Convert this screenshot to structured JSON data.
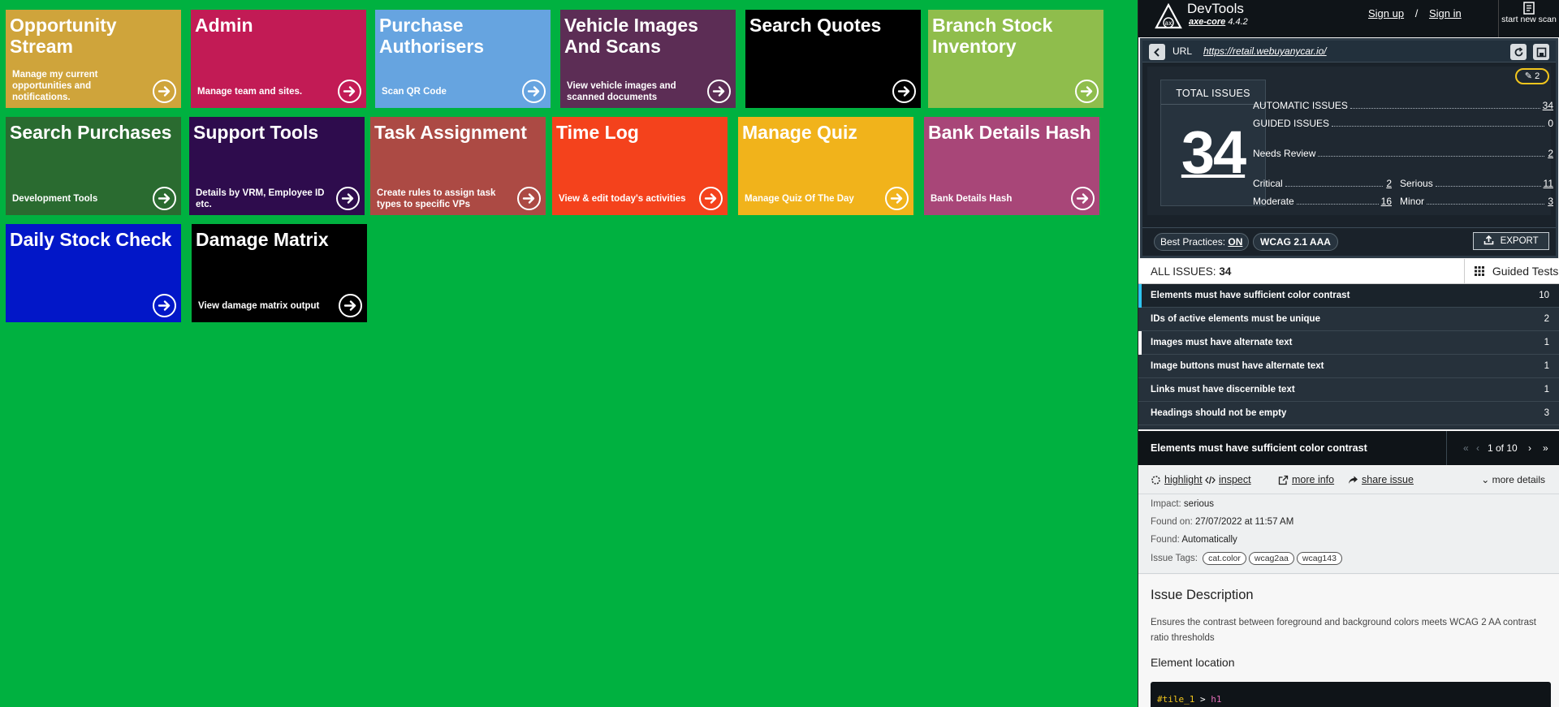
{
  "tiles": [
    {
      "title": "Opportunity Stream",
      "desc": "Manage my current opportunities and notifications.",
      "color": "#cfa43b"
    },
    {
      "title": "Admin",
      "desc": "Manage team and sites.",
      "color": "#c21b55"
    },
    {
      "title": "Purchase Authorisers",
      "desc": "Scan QR Code",
      "color": "#66a4e0"
    },
    {
      "title": "Vehicle Images And Scans",
      "desc": "View vehicle images and scanned documents",
      "color": "#5c2d55"
    },
    {
      "title": "Search Quotes",
      "desc": "",
      "color": "#000000"
    },
    {
      "title": "Branch Stock Inventory",
      "desc": "",
      "color": "#8fbd4c"
    },
    {
      "title": "Search Purchases",
      "desc": "Development Tools",
      "color": "#2a6b30"
    },
    {
      "title": "Support Tools",
      "desc": "Details by VRM, Employee ID etc.",
      "color": "#2e0c4d"
    },
    {
      "title": "Task Assignment",
      "desc": "Create rules to assign task types to specific VPs",
      "color": "#ac4a44"
    },
    {
      "title": "Time Log",
      "desc": "View & edit today's activities",
      "color": "#f4421c"
    },
    {
      "title": "Manage Quiz",
      "desc": "Manage Quiz Of The Day",
      "color": "#f1b31b"
    },
    {
      "title": "Bank Details Hash",
      "desc": "Bank Details Hash",
      "color": "#a84678"
    },
    {
      "title": "Daily Stock Check",
      "desc": "",
      "color": "#0217c8"
    },
    {
      "title": "Damage Matrix",
      "desc": "View damage matrix output",
      "color": "#000000"
    }
  ],
  "devtools": {
    "title": "DevTools",
    "core_name": "axe-core",
    "version": "4.4.2",
    "sign_up": "Sign up",
    "separator": "/",
    "sign_in": "Sign in",
    "new_scan": "start new scan",
    "url_label": "URL",
    "url": "https://retail.webuyanycar.io/",
    "edit_count": "2",
    "total_label": "TOTAL ISSUES",
    "total": "34",
    "stats": {
      "automatic": {
        "label": "AUTOMATIC ISSUES",
        "value": "34"
      },
      "guided": {
        "label": "GUIDED ISSUES",
        "value": "0"
      },
      "needs_review": {
        "label": "Needs Review",
        "value": "2"
      },
      "critical": {
        "label": "Critical",
        "value": "2"
      },
      "serious": {
        "label": "Serious",
        "value": "11"
      },
      "moderate": {
        "label": "Moderate",
        "value": "16"
      },
      "minor": {
        "label": "Minor",
        "value": "3"
      }
    },
    "best_practices_label": "Best Practices:",
    "best_practices_value": "ON",
    "wcag": "WCAG 2.1 AAA",
    "export": "EXPORT",
    "all_issues_label": "ALL ISSUES:",
    "all_issues_count": "34",
    "guided_tests": "Guided Tests",
    "issues": [
      {
        "label": "Elements must have sufficient color contrast",
        "count": "10",
        "marker": "#2ec4f0"
      },
      {
        "label": "IDs of active elements must be unique",
        "count": "2",
        "marker": ""
      },
      {
        "label": "Images must have alternate text",
        "count": "1",
        "marker": "#ffffff"
      },
      {
        "label": "Image buttons must have alternate text",
        "count": "1",
        "marker": ""
      },
      {
        "label": "Links must have discernible text",
        "count": "1",
        "marker": ""
      },
      {
        "label": "Headings should not be empty",
        "count": "3",
        "marker": ""
      }
    ],
    "detail": {
      "title": "Elements must have sufficient color contrast",
      "pager": "1 of 10",
      "actions": {
        "highlight": "highlight",
        "inspect": "inspect",
        "more_info": "more info",
        "share": "share issue",
        "more_details": "more details"
      },
      "impact_label": "Impact:",
      "impact": "serious",
      "found_on_label": "Found on:",
      "found_on": "27/07/2022 at 11:57 AM",
      "found_label": "Found:",
      "found": "Automatically",
      "tags_label": "Issue Tags:",
      "tags": [
        "cat.color",
        "wcag2aa",
        "wcag143"
      ],
      "desc_title": "Issue Description",
      "desc": "Ensures the contrast between foreground and background colors meets WCAG 2 AA contrast ratio thresholds",
      "loc_title": "Element location",
      "code_selector": "#tile_1",
      "code_op": " > ",
      "code_tag": "h1"
    }
  }
}
